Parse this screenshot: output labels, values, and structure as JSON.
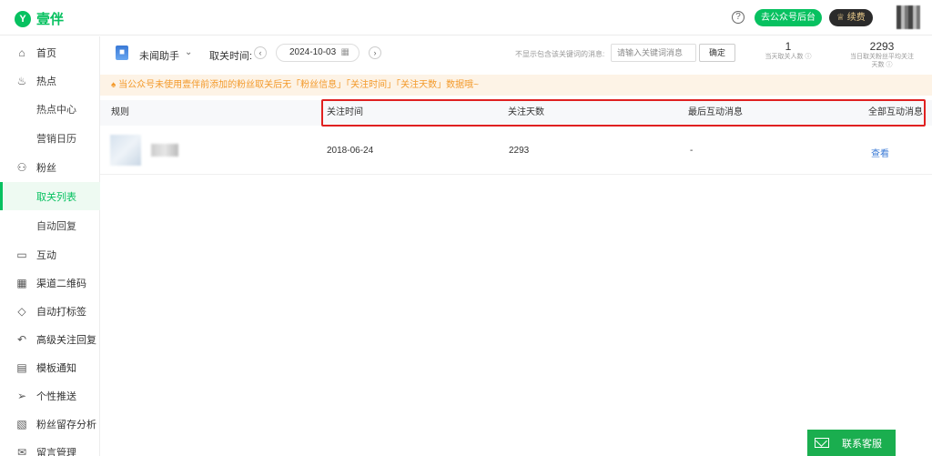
{
  "app": {
    "logo_mark": "Y",
    "logo_text": "壹伴"
  },
  "topbar": {
    "help": "?",
    "backend_button": "去公众号后台",
    "renew_button": "续费"
  },
  "sidebar": {
    "items": [
      {
        "label": "首页",
        "icon": "home-icon",
        "glyph": "⌂"
      },
      {
        "label": "热点",
        "icon": "fire-icon",
        "glyph": "♨"
      },
      {
        "label": "热点中心",
        "sub": true
      },
      {
        "label": "营销日历",
        "sub": true
      },
      {
        "label": "粉丝",
        "icon": "user-icon",
        "glyph": "⚇"
      },
      {
        "label": "取关列表",
        "sub": true,
        "active": true
      },
      {
        "label": "自动回复",
        "sub": true
      },
      {
        "label": "互动",
        "icon": "chat-icon",
        "glyph": "▭"
      },
      {
        "label": "渠道二维码",
        "icon": "qrcode-icon",
        "glyph": "▦"
      },
      {
        "label": "自动打标签",
        "icon": "tag-icon",
        "glyph": "◇"
      },
      {
        "label": "高级关注回复",
        "icon": "reply-icon",
        "glyph": "↶"
      },
      {
        "label": "模板通知",
        "icon": "template-icon",
        "glyph": "▤"
      },
      {
        "label": "个性推送",
        "icon": "send-icon",
        "glyph": "➢"
      },
      {
        "label": "粉丝留存分析",
        "icon": "analysis-icon",
        "glyph": "▧"
      },
      {
        "label": "留言管理",
        "icon": "message-icon",
        "glyph": "✉"
      }
    ]
  },
  "filter": {
    "account_name": "未闻助手",
    "time_label": "取关时间:",
    "prev": "‹",
    "next": "›",
    "date": "2024-10-03",
    "keyword_label": "不显示包含该关键词的消息:",
    "keyword_placeholder": "请输入关键词消息",
    "confirm": "确定"
  },
  "stats": [
    {
      "value": "1",
      "label": "当天取关人数 ⓘ"
    },
    {
      "value": "2293",
      "label": "当日取关粉丝平均关注天数 ⓘ"
    }
  ],
  "notice": "♠ 当公众号未使用壹伴前添加的粉丝取关后无「粉丝信息」「关注时间」「关注天数」数据哦~",
  "table": {
    "headers": [
      "规则",
      "关注时间",
      "关注天数",
      "最后互动消息",
      "全部互动消息"
    ],
    "rows": [
      {
        "follow_time": "2018-06-24",
        "days": "2293",
        "last_msg": "-",
        "action": "查看"
      }
    ]
  },
  "service": {
    "label": "联系客服"
  },
  "colors": {
    "brand": "#07c160",
    "highlight": "#e02020",
    "link": "#3a7ad6",
    "notice": "#f39a2b"
  }
}
